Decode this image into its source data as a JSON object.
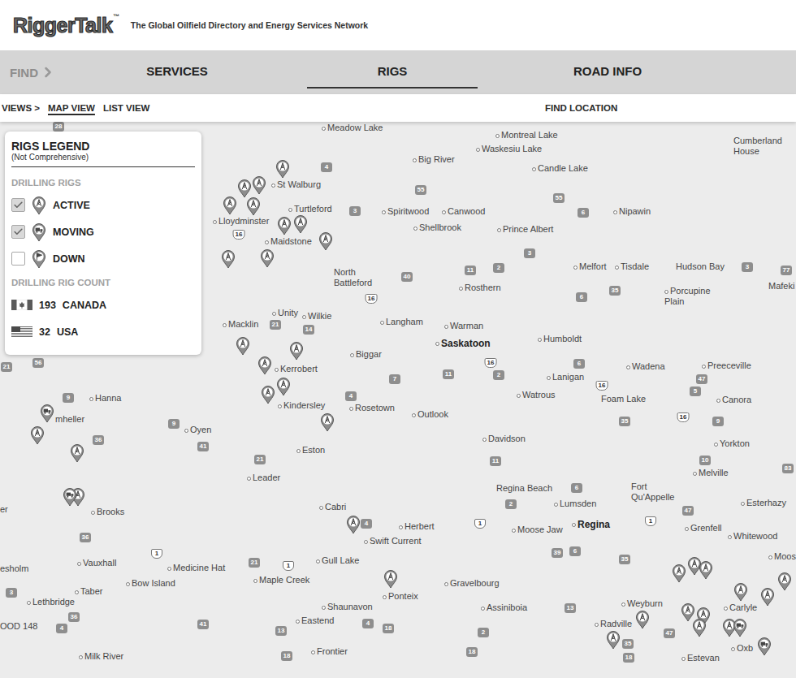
{
  "header": {
    "logo": "RiggerTalk",
    "trademark": "™",
    "tagline": "The Global Oilfield Directory and Energy Services Network"
  },
  "nav": {
    "find": "FIND",
    "items": [
      {
        "label": "SERVICES",
        "selected": false
      },
      {
        "label": "RIGS",
        "selected": true
      },
      {
        "label": "ROAD INFO",
        "selected": false
      }
    ]
  },
  "views": {
    "label": "VIEWS >",
    "options": [
      {
        "label": "MAP VIEW",
        "selected": true
      },
      {
        "label": "LIST VIEW",
        "selected": false
      }
    ],
    "find_location": "FIND LOCATION"
  },
  "legend": {
    "title": "RIGS LEGEND",
    "subtitle": "(Not Comprehensive)",
    "rigs_heading": "DRILLING RIGS",
    "rig_types": [
      {
        "label": "ACTIVE",
        "kind": "active",
        "checked": true
      },
      {
        "label": "MOVING",
        "kind": "moving",
        "checked": true
      },
      {
        "label": "DOWN",
        "kind": "down",
        "checked": false
      }
    ],
    "count_heading": "DRILLING RIG COUNT",
    "counts": [
      {
        "count": "193",
        "country": "CANADA",
        "kind": "canada"
      },
      {
        "count": "32",
        "country": "USA",
        "kind": "usa"
      }
    ]
  },
  "map": {
    "places": [
      {
        "name": "Meadow Lake",
        "kind": "town"
      },
      {
        "name": "Montreal Lake",
        "kind": "town"
      },
      {
        "name": "Waskesiu Lake",
        "kind": "town"
      },
      {
        "name": "Big River",
        "kind": "town"
      },
      {
        "name": "Candle Lake",
        "kind": "town"
      },
      {
        "name": "Cumberland House",
        "kind": "label"
      },
      {
        "name": "St Walburg",
        "kind": "town"
      },
      {
        "name": "Turtleford",
        "kind": "town"
      },
      {
        "name": "Spiritwood",
        "kind": "town"
      },
      {
        "name": "Canwood",
        "kind": "town"
      },
      {
        "name": "Nipawin",
        "kind": "town"
      },
      {
        "name": "Lloydminster",
        "kind": "town"
      },
      {
        "name": "Shellbrook",
        "kind": "town"
      },
      {
        "name": "Prince Albert",
        "kind": "town"
      },
      {
        "name": "Maidstone",
        "kind": "town"
      },
      {
        "name": "North Battleford",
        "kind": "label"
      },
      {
        "name": "Melfort",
        "kind": "town"
      },
      {
        "name": "Tisdale",
        "kind": "town"
      },
      {
        "name": "Hudson Bay",
        "kind": "label"
      },
      {
        "name": "Mafeki",
        "kind": "label"
      },
      {
        "name": "Rosthern",
        "kind": "town"
      },
      {
        "name": "Porcupine Plain",
        "kind": "town"
      },
      {
        "name": "Macklin",
        "kind": "town"
      },
      {
        "name": "Unity",
        "kind": "town"
      },
      {
        "name": "Wilkie",
        "kind": "town"
      },
      {
        "name": "Langham",
        "kind": "town"
      },
      {
        "name": "Warman",
        "kind": "town"
      },
      {
        "name": "Saskatoon",
        "kind": "city"
      },
      {
        "name": "Humboldt",
        "kind": "town"
      },
      {
        "name": "Biggar",
        "kind": "town"
      },
      {
        "name": "Kerrobert",
        "kind": "town"
      },
      {
        "name": "Wadena",
        "kind": "town"
      },
      {
        "name": "Preeceville",
        "kind": "town"
      },
      {
        "name": "Lanigan",
        "kind": "town"
      },
      {
        "name": "Hanna",
        "kind": "town"
      },
      {
        "name": "Watrous",
        "kind": "town"
      },
      {
        "name": "Foam Lake",
        "kind": "label"
      },
      {
        "name": "Canora",
        "kind": "town"
      },
      {
        "name": "Kindersley",
        "kind": "town"
      },
      {
        "name": "Rosetown",
        "kind": "town"
      },
      {
        "name": "Outlook",
        "kind": "town"
      },
      {
        "name": "mheller",
        "kind": "label"
      },
      {
        "name": "Oyen",
        "kind": "town"
      },
      {
        "name": "Davidson",
        "kind": "town"
      },
      {
        "name": "Yorkton",
        "kind": "town"
      },
      {
        "name": "Eston",
        "kind": "town"
      },
      {
        "name": "Melville",
        "kind": "town"
      },
      {
        "name": "Leader",
        "kind": "town"
      },
      {
        "name": "Regina Beach",
        "kind": "label"
      },
      {
        "name": "Fort Qu'Appelle",
        "kind": "label"
      },
      {
        "name": "Esterhazy",
        "kind": "town"
      },
      {
        "name": "Cabri",
        "kind": "town"
      },
      {
        "name": "Brooks",
        "kind": "town"
      },
      {
        "name": "Lumsden",
        "kind": "town"
      },
      {
        "name": "er",
        "kind": "label"
      },
      {
        "name": "Herbert",
        "kind": "town"
      },
      {
        "name": "Moose Jaw",
        "kind": "town"
      },
      {
        "name": "Regina",
        "kind": "city"
      },
      {
        "name": "Grenfell",
        "kind": "town"
      },
      {
        "name": "Whitewood",
        "kind": "town"
      },
      {
        "name": "Swift Current",
        "kind": "town"
      },
      {
        "name": "Moos",
        "kind": "town"
      },
      {
        "name": "Vauxhall",
        "kind": "town"
      },
      {
        "name": "Gull Lake",
        "kind": "town"
      },
      {
        "name": "Medicine Hat",
        "kind": "town"
      },
      {
        "name": "esholm",
        "kind": "label"
      },
      {
        "name": "Maple Creek",
        "kind": "town"
      },
      {
        "name": "Bow Island",
        "kind": "town"
      },
      {
        "name": "Gravelbourg",
        "kind": "town"
      },
      {
        "name": "Taber",
        "kind": "town"
      },
      {
        "name": "Ponteix",
        "kind": "town"
      },
      {
        "name": "Lethbridge",
        "kind": "town"
      },
      {
        "name": "Weyburn",
        "kind": "town"
      },
      {
        "name": "Shaunavon",
        "kind": "town"
      },
      {
        "name": "Assiniboia",
        "kind": "town"
      },
      {
        "name": "Carlyle",
        "kind": "town"
      },
      {
        "name": "Eastend",
        "kind": "town"
      },
      {
        "name": "Radville",
        "kind": "town"
      },
      {
        "name": "OOD 148",
        "kind": "label"
      },
      {
        "name": "Frontier",
        "kind": "town"
      },
      {
        "name": "Milk River",
        "kind": "town"
      },
      {
        "name": "Estevan",
        "kind": "town"
      },
      {
        "name": "Oxb",
        "kind": "town"
      }
    ],
    "roads": [
      {
        "number": "28",
        "kind": "highway"
      },
      {
        "number": "4",
        "kind": "highway"
      },
      {
        "number": "55",
        "kind": "highway"
      },
      {
        "number": "55",
        "kind": "highway"
      },
      {
        "number": "3",
        "kind": "highway"
      },
      {
        "number": "6",
        "kind": "highway"
      },
      {
        "number": "16",
        "kind": "trans-canada"
      },
      {
        "number": "3",
        "kind": "highway"
      },
      {
        "number": "2",
        "kind": "highway"
      },
      {
        "number": "11",
        "kind": "highway"
      },
      {
        "number": "3",
        "kind": "highway"
      },
      {
        "number": "77",
        "kind": "highway"
      },
      {
        "number": "40",
        "kind": "highway"
      },
      {
        "number": "16",
        "kind": "trans-canada"
      },
      {
        "number": "35",
        "kind": "highway"
      },
      {
        "number": "6",
        "kind": "highway"
      },
      {
        "number": "21",
        "kind": "highway"
      },
      {
        "number": "14",
        "kind": "highway"
      },
      {
        "number": "16",
        "kind": "trans-canada"
      },
      {
        "number": "6",
        "kind": "highway"
      },
      {
        "number": "11",
        "kind": "highway"
      },
      {
        "number": "2",
        "kind": "highway"
      },
      {
        "number": "47",
        "kind": "highway"
      },
      {
        "number": "7",
        "kind": "highway"
      },
      {
        "number": "16",
        "kind": "trans-canada"
      },
      {
        "number": "5",
        "kind": "highway"
      },
      {
        "number": "9",
        "kind": "highway"
      },
      {
        "number": "4",
        "kind": "highway"
      },
      {
        "number": "16",
        "kind": "trans-canada"
      },
      {
        "number": "9",
        "kind": "highway"
      },
      {
        "number": "35",
        "kind": "highway"
      },
      {
        "number": "9",
        "kind": "highway"
      },
      {
        "number": "36",
        "kind": "highway"
      },
      {
        "number": "41",
        "kind": "highway"
      },
      {
        "number": "21",
        "kind": "highway"
      },
      {
        "number": "10",
        "kind": "highway"
      },
      {
        "number": "11",
        "kind": "highway"
      },
      {
        "number": "83",
        "kind": "highway"
      },
      {
        "number": "6",
        "kind": "highway"
      },
      {
        "number": "2",
        "kind": "highway"
      },
      {
        "number": "47",
        "kind": "highway"
      },
      {
        "number": "1",
        "kind": "trans-canada"
      },
      {
        "number": "4",
        "kind": "highway"
      },
      {
        "number": "1",
        "kind": "trans-canada"
      },
      {
        "number": "36",
        "kind": "highway"
      },
      {
        "number": "39",
        "kind": "highway"
      },
      {
        "number": "6",
        "kind": "highway"
      },
      {
        "number": "1",
        "kind": "trans-canada"
      },
      {
        "number": "35",
        "kind": "highway"
      },
      {
        "number": "21",
        "kind": "highway"
      },
      {
        "number": "1",
        "kind": "trans-canada"
      },
      {
        "number": "3",
        "kind": "highway"
      },
      {
        "number": "13",
        "kind": "highway"
      },
      {
        "number": "36",
        "kind": "highway"
      },
      {
        "number": "41",
        "kind": "highway"
      },
      {
        "number": "4",
        "kind": "highway"
      },
      {
        "number": "4",
        "kind": "highway"
      },
      {
        "number": "18",
        "kind": "highway"
      },
      {
        "number": "13",
        "kind": "highway"
      },
      {
        "number": "2",
        "kind": "highway"
      },
      {
        "number": "47",
        "kind": "highway"
      },
      {
        "number": "35",
        "kind": "highway"
      },
      {
        "number": "18",
        "kind": "highway"
      },
      {
        "number": "18",
        "kind": "highway"
      },
      {
        "number": "18",
        "kind": "highway"
      },
      {
        "number": "56",
        "kind": "highway"
      },
      {
        "number": "21",
        "kind": "highway"
      }
    ],
    "pins": [
      {
        "kind": "active"
      },
      {
        "kind": "active"
      },
      {
        "kind": "active"
      },
      {
        "kind": "active"
      },
      {
        "kind": "active"
      },
      {
        "kind": "active"
      },
      {
        "kind": "active"
      },
      {
        "kind": "active"
      },
      {
        "kind": "active"
      },
      {
        "kind": "active"
      },
      {
        "kind": "active"
      },
      {
        "kind": "active"
      },
      {
        "kind": "active"
      },
      {
        "kind": "active"
      },
      {
        "kind": "active"
      },
      {
        "kind": "active"
      },
      {
        "kind": "active"
      },
      {
        "kind": "active"
      },
      {
        "kind": "active"
      },
      {
        "kind": "active"
      },
      {
        "kind": "active"
      },
      {
        "kind": "active"
      },
      {
        "kind": "active"
      },
      {
        "kind": "active"
      },
      {
        "kind": "active"
      },
      {
        "kind": "active"
      },
      {
        "kind": "active"
      },
      {
        "kind": "active"
      },
      {
        "kind": "active"
      },
      {
        "kind": "active"
      },
      {
        "kind": "active"
      },
      {
        "kind": "active"
      },
      {
        "kind": "active"
      },
      {
        "kind": "moving"
      },
      {
        "kind": "moving"
      },
      {
        "kind": "moving"
      },
      {
        "kind": "moving"
      }
    ]
  }
}
